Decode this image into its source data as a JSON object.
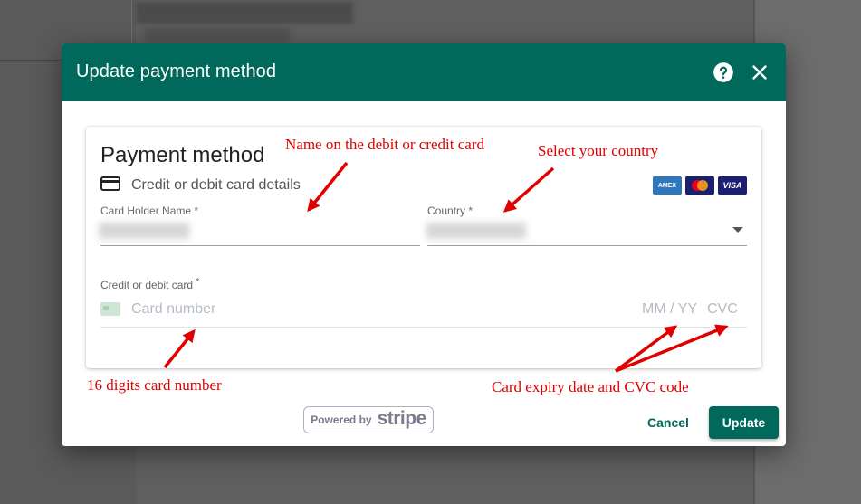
{
  "dialog": {
    "title": "Update payment method",
    "help_icon": "help-circle-icon",
    "close_icon": "close-icon"
  },
  "card": {
    "title": "Payment method",
    "subtitle_icon": "credit-card-icon",
    "subtitle": "Credit or debit card details",
    "brands": [
      "AMERICAN EXPRESS",
      "mastercard",
      "VISA"
    ]
  },
  "fields": {
    "holder_label": "Card Holder Name *",
    "country_label": "Country *",
    "card_label": "Credit or debit card",
    "card_required": "*",
    "card_placeholder": "Card number",
    "expiry_placeholder": "MM / YY",
    "cvc_placeholder": "CVC"
  },
  "footer": {
    "powered_by": "Powered by",
    "stripe": "stripe",
    "cancel_label": "Cancel",
    "update_label": "Update"
  },
  "annotations": {
    "name_note": "Name on the debit or credit card",
    "country_note": "Select your country",
    "card_number_note": "16 digits card number",
    "expiry_note": "Card expiry date and CVC code"
  },
  "colors": {
    "primary": "#00695c",
    "annotation": "#e00000",
    "overlay": "#5f5f5f"
  }
}
